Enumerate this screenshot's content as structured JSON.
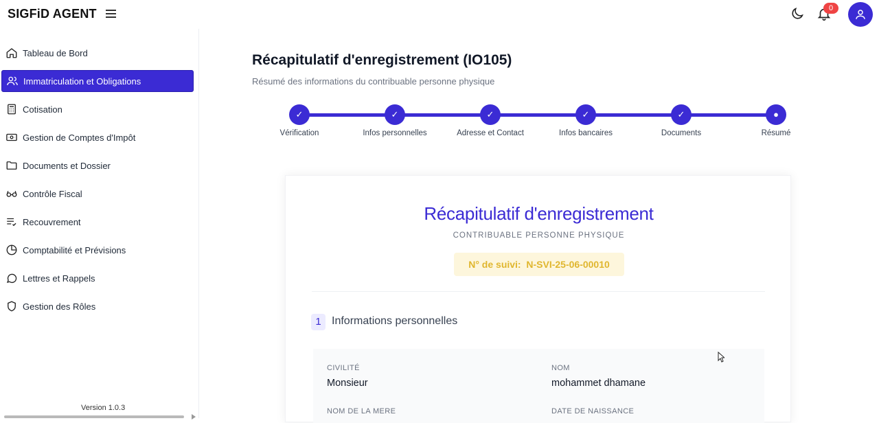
{
  "app": {
    "brand": "SIGFiD AGENT",
    "notification_count": "0"
  },
  "sidebar": {
    "items": [
      {
        "label": "Tableau de Bord",
        "icon": "home-icon"
      },
      {
        "label": "Immatriculation et Obligations",
        "icon": "users-icon"
      },
      {
        "label": "Cotisation",
        "icon": "calculator-icon"
      },
      {
        "label": "Gestion de Comptes d'Impôt",
        "icon": "banknote-icon"
      },
      {
        "label": "Documents et Dossier",
        "icon": "folder-icon"
      },
      {
        "label": "Contrôle Fiscal",
        "icon": "glasses-icon"
      },
      {
        "label": "Recouvrement",
        "icon": "list-check-icon"
      },
      {
        "label": "Comptabilité et Prévisions",
        "icon": "pie-chart-icon"
      },
      {
        "label": "Lettres et Rappels",
        "icon": "message-circle-icon"
      },
      {
        "label": "Gestion des Rôles",
        "icon": "shield-icon"
      }
    ],
    "active_index": 1,
    "version": "Version 1.0.3"
  },
  "page": {
    "title": "Récapitulatif d'enregistrement (IO105)",
    "subtitle": "Résumé des informations du contribuable personne physique"
  },
  "stepper": {
    "steps": [
      {
        "label": "Vérification",
        "state": "done",
        "glyph": "✓"
      },
      {
        "label": "Infos personnelles",
        "state": "done",
        "glyph": "✓"
      },
      {
        "label": "Adresse et Contact",
        "state": "done",
        "glyph": "✓"
      },
      {
        "label": "Infos bancaires",
        "state": "done",
        "glyph": "✓"
      },
      {
        "label": "Documents",
        "state": "done",
        "glyph": "✓"
      },
      {
        "label": "Résumé",
        "state": "current",
        "glyph": "●"
      }
    ]
  },
  "summary": {
    "title": "Récapitulatif d'enregistrement",
    "subtitle": "CONTRIBUABLE PERSONNE PHYSIQUE",
    "tracking_label": "N° de suivi:",
    "tracking_value": "N-SVI-25-06-00010",
    "section": {
      "number": "1",
      "title": "Informations personnelles"
    },
    "fields": [
      {
        "label": "CIVILITÉ",
        "value": "Monsieur"
      },
      {
        "label": "NOM",
        "value": "mohammet dhamane"
      },
      {
        "label": "NOM DE LA MERE",
        "value": ""
      },
      {
        "label": "DATE DE NAISSANCE",
        "value": ""
      }
    ]
  },
  "colors": {
    "accent": "#3b2bd4",
    "badge": "#ef4444",
    "tracking": "#e0b62e"
  }
}
